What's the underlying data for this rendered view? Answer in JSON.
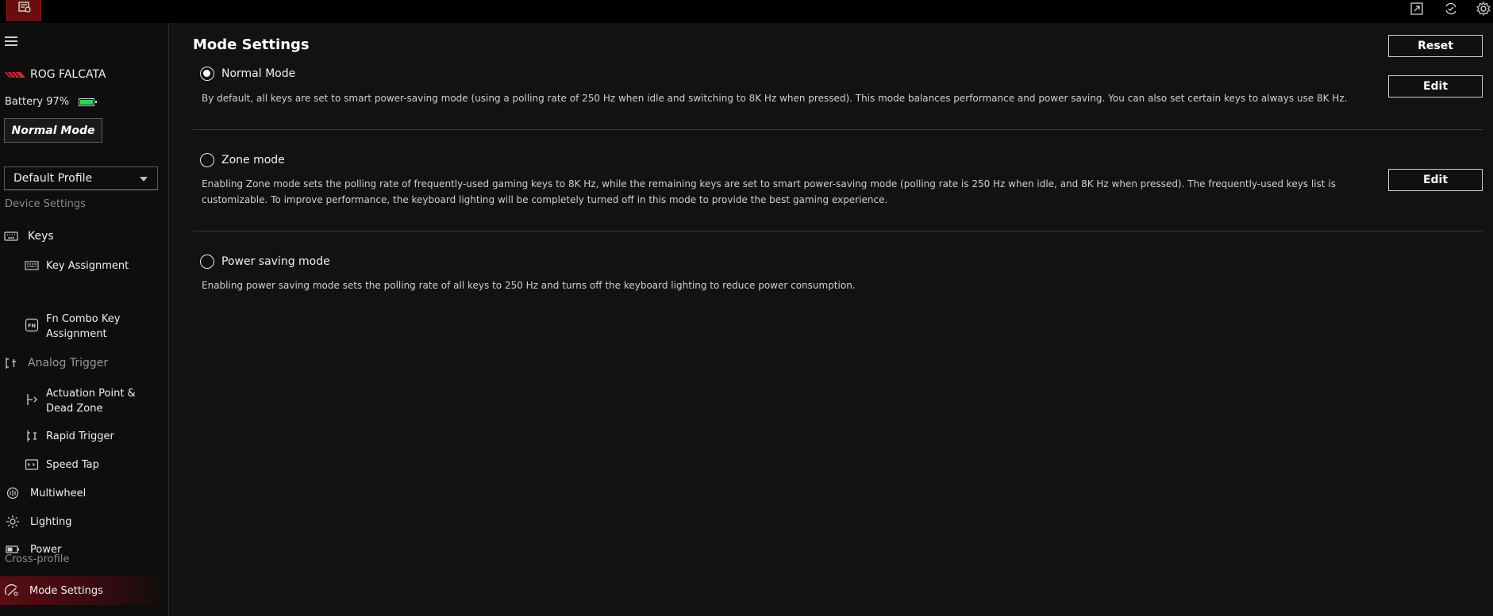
{
  "device": {
    "name": "ROG FALCATA",
    "battery_label": "Battery 97%",
    "battery_level": 0.97,
    "battery_color": "#2dd35a",
    "brand_color": "#d4262f"
  },
  "current_mode_badge": "Normal Mode",
  "profile": {
    "selected": "Default Profile"
  },
  "sidebar": {
    "device_settings_label": "Device Settings",
    "keys": "Keys",
    "key_assignment": "Key Assignment",
    "fn_combo": "Fn Combo Key Assignment",
    "analog_trigger": "Analog Trigger",
    "actuation": "Actuation Point & Dead Zone",
    "rapid_trigger": "Rapid Trigger",
    "speed_tap": "Speed Tap",
    "multiwheel": "Multiwheel",
    "lighting": "Lighting",
    "power": "Power",
    "cross_profile_label": "Cross-profile",
    "mode_settings": "Mode Settings"
  },
  "main": {
    "title": "Mode Settings",
    "reset_label": "Reset",
    "edit_label": "Edit",
    "modes": [
      {
        "name": "Normal Mode",
        "selected": true,
        "description": "By default, all keys are set to smart power-saving mode (using a polling rate of 250 Hz when idle and switching to 8K Hz when pressed). This mode balances performance and power saving. You can also set certain keys to always use 8K Hz."
      },
      {
        "name": "Zone mode",
        "selected": false,
        "description": "Enabling Zone mode sets the polling rate of frequently-used gaming keys to 8K Hz, while the remaining keys are set to smart power-saving mode (polling rate is 250 Hz when idle, and 8K Hz when pressed). The frequently-used keys list is customizable. To improve performance, the keyboard lighting will be completely turned off in this mode to provide the best gaming experience."
      },
      {
        "name": "Power saving mode",
        "selected": false,
        "description": "Enabling power saving mode sets the polling rate of all keys to 250 Hz and turns off the keyboard lighting to reduce power consumption."
      }
    ]
  },
  "icons": {
    "topbar": [
      "app-logo-icon",
      "expand-icon",
      "sync-icon",
      "settings-icon"
    ]
  }
}
